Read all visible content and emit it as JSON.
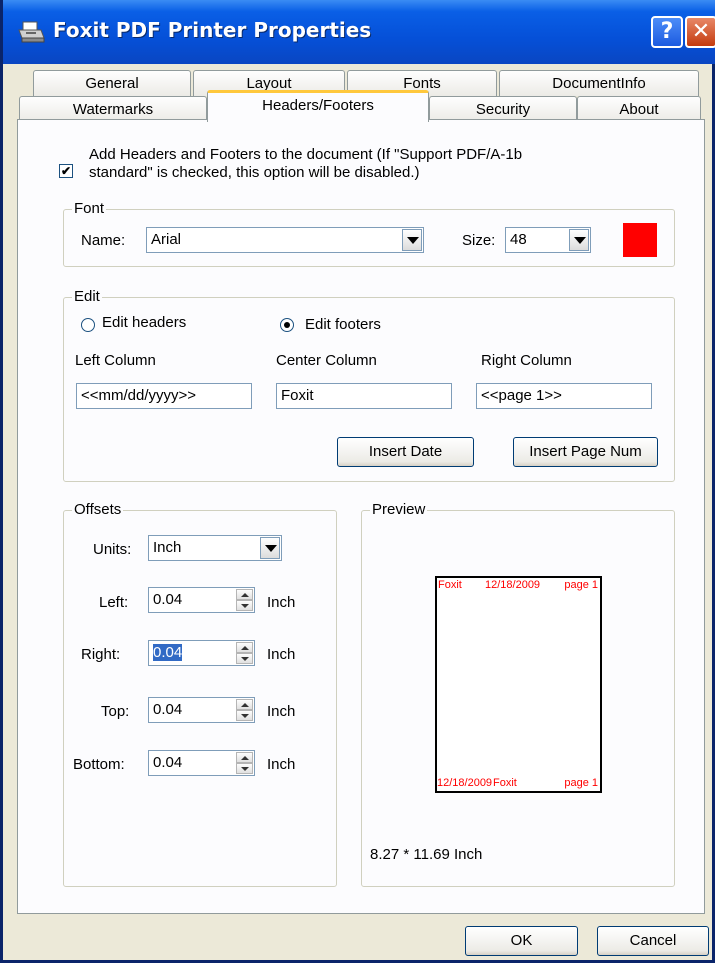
{
  "window": {
    "title": "Foxit PDF Printer Properties",
    "help_label": "?",
    "close_label": "✕"
  },
  "tabs": {
    "row1": [
      "General",
      "Layout",
      "Fonts",
      "DocumentInfo"
    ],
    "row2": [
      "Watermarks",
      "Headers/Footers",
      "Security",
      "About"
    ],
    "active": "Headers/Footers"
  },
  "options": {
    "enable_checked": true,
    "enable_label_line1": "Add Headers and Footers to the document (If \"Support PDF/A-1b",
    "enable_label_line2": "standard\" is checked, this option will be disabled.)"
  },
  "font": {
    "legend": "Font",
    "name_label": "Name:",
    "name_value": "Arial",
    "size_label": "Size:",
    "size_value": "48",
    "color": "#FF0000"
  },
  "edit": {
    "legend": "Edit",
    "edit_headers_label": "Edit headers",
    "edit_footers_label": "Edit footers",
    "selected": "Edit footers",
    "left_column_label": "Left Column",
    "center_column_label": "Center Column",
    "right_column_label": "Right Column",
    "left_value": "<<mm/dd/yyyy>>",
    "center_value": "Foxit",
    "right_value": "<<page 1>>",
    "insert_date_label": "Insert Date",
    "insert_page_num_label": "Insert Page Num"
  },
  "offsets": {
    "legend": "Offsets",
    "units_label": "Units:",
    "units_value": "Inch",
    "left_label": "Left:",
    "left_value": "0.04",
    "right_label": "Right:",
    "right_value": "0.04",
    "top_label": "Top:",
    "top_value": "0.04",
    "bottom_label": "Bottom:",
    "bottom_value": "0.04",
    "unit_suffix": "Inch"
  },
  "preview": {
    "legend": "Preview",
    "header_left": "Foxit",
    "header_center": "12/18/2009",
    "header_right": "page 1",
    "footer_left": "12/18/2009",
    "footer_center": "Foxit",
    "footer_right": "page 1",
    "paper_size": "8.27 * 11.69 Inch",
    "text_color": "#FF0000"
  },
  "footer_buttons": {
    "ok_label": "OK",
    "cancel_label": "Cancel"
  }
}
